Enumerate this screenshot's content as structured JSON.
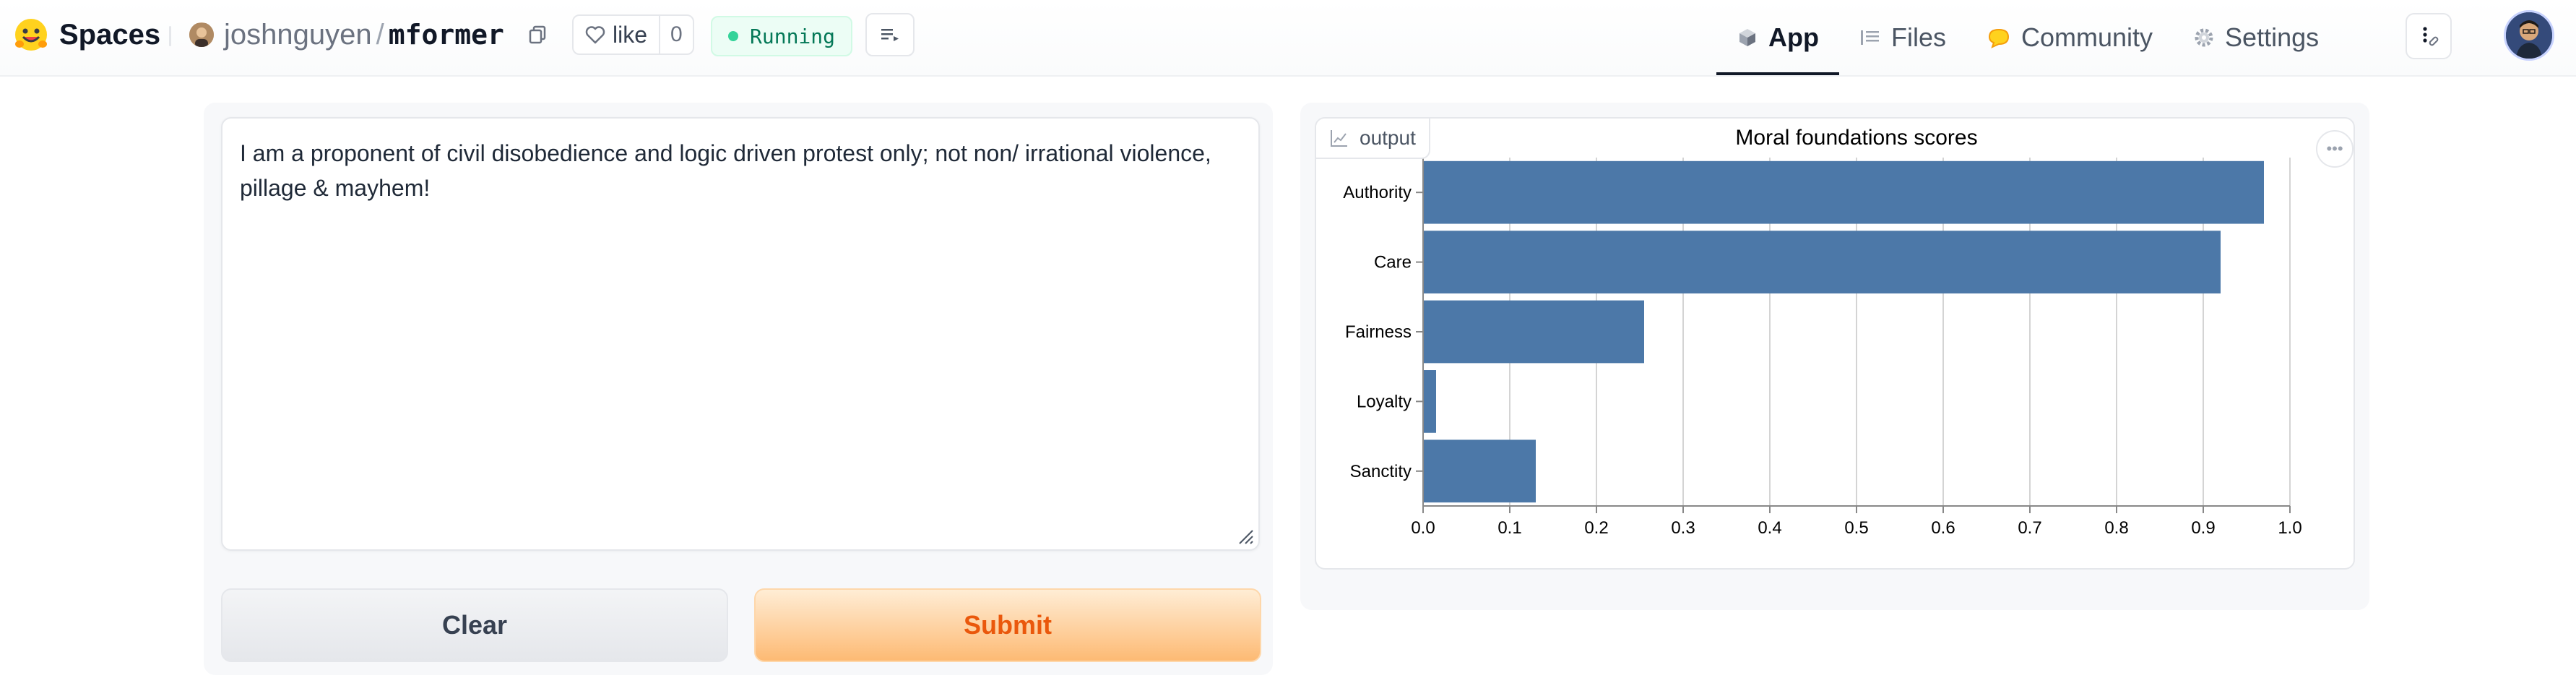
{
  "header": {
    "brand": "Spaces",
    "owner": "joshnguyen",
    "repo": "mformer",
    "like_label": "like",
    "like_count": "0",
    "status": "Running",
    "nav": [
      {
        "label": "App",
        "icon": "cube-icon",
        "active": true
      },
      {
        "label": "Files",
        "icon": "files-icon",
        "active": false
      },
      {
        "label": "Community",
        "icon": "community-icon",
        "active": false
      },
      {
        "label": "Settings",
        "icon": "gear-icon",
        "active": false
      }
    ]
  },
  "input": {
    "text": "I am a proponent of civil disobedience and logic driven protest only; not non/ irrational violence, pillage & mayhem!"
  },
  "buttons": {
    "clear": "Clear",
    "submit": "Submit"
  },
  "output": {
    "tab_label": "output"
  },
  "chart_data": {
    "type": "bar",
    "orientation": "horizontal",
    "title": "Moral foundations scores",
    "categories": [
      "Authority",
      "Care",
      "Fairness",
      "Loyalty",
      "Sanctity"
    ],
    "values": [
      0.97,
      0.92,
      0.255,
      0.015,
      0.13
    ],
    "xlim": [
      0,
      1.0
    ],
    "xticks": [
      "0.0",
      "0.1",
      "0.2",
      "0.3",
      "0.4",
      "0.5",
      "0.6",
      "0.7",
      "0.8",
      "0.9",
      "1.0"
    ],
    "grid": true,
    "bar_color": "#4c78a8"
  },
  "colors": {
    "accent": "#ea580c",
    "running": "#047857"
  }
}
